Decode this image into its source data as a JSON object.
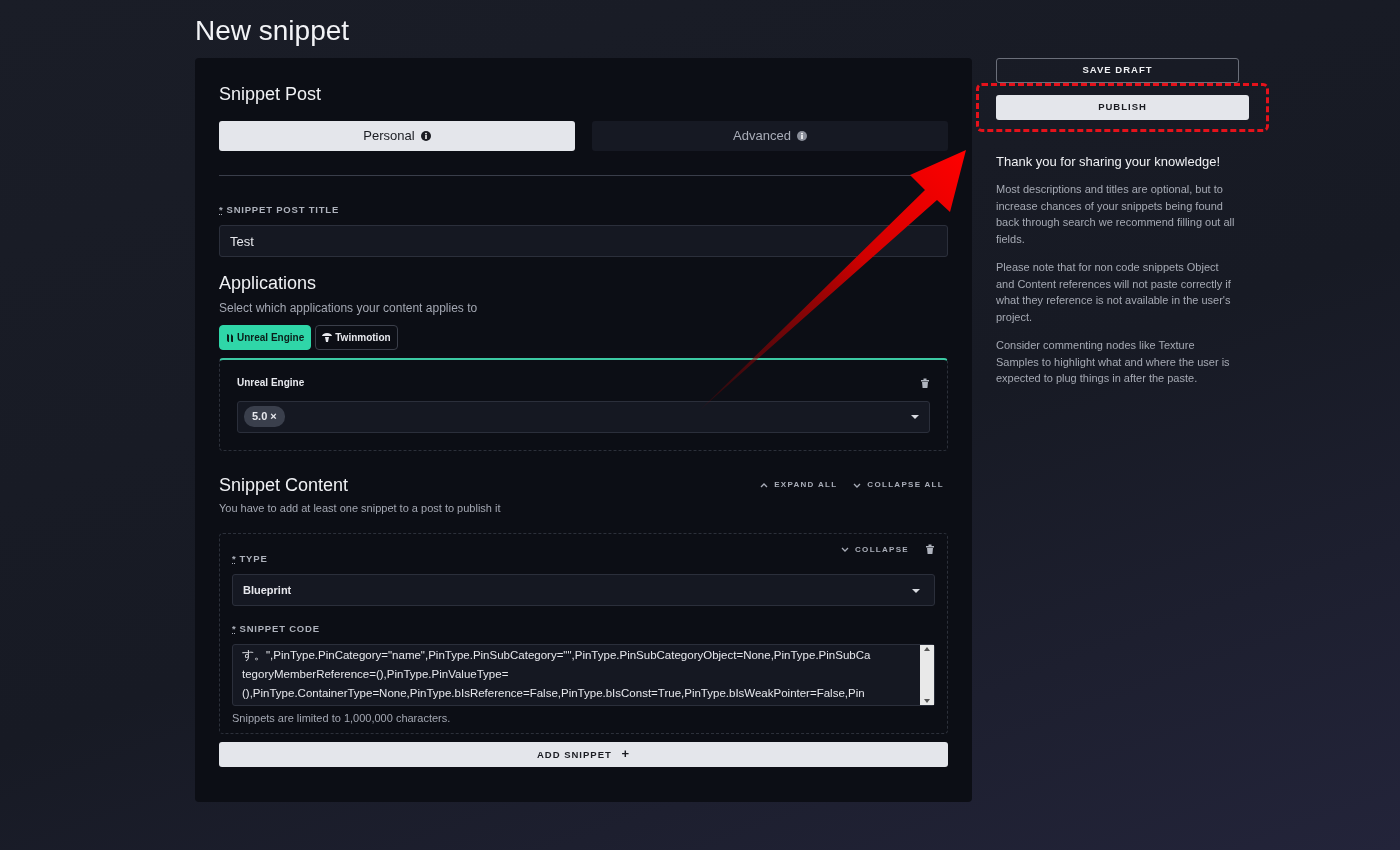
{
  "page_title": "New snippet",
  "form": {
    "heading": "Snippet Post",
    "tabs": [
      {
        "label": "Personal",
        "selected": true
      },
      {
        "label": "Advanced",
        "selected": false
      }
    ],
    "title_field": {
      "required_mark": "*",
      "label": "SNIPPET POST TITLE",
      "value": "Test"
    },
    "applications": {
      "heading": "Applications",
      "hint": "Select which applications your content applies to",
      "chips": [
        {
          "label": "Unreal Engine",
          "selected": true
        },
        {
          "label": "Twinmotion",
          "selected": false
        }
      ],
      "panel": {
        "label": "Unreal Engine",
        "tags": [
          "5.0"
        ],
        "tag_remove": "×"
      }
    },
    "content": {
      "heading": "Snippet Content",
      "hint": "You have to add at least one snippet to a post to publish it",
      "expand_all": "EXPAND ALL",
      "collapse_all": "COLLAPSE ALL",
      "snippet": {
        "collapse": "COLLAPSE",
        "type_field": {
          "required_mark": "*",
          "label": "TYPE",
          "value": "Blueprint"
        },
        "code_field": {
          "required_mark": "*",
          "label": "SNIPPET CODE",
          "lines": [
            "す。\",PinType.PinCategory=\"name\",PinType.PinSubCategory=\"\",PinType.PinSubCategoryObject=None,PinType.PinSubCa",
            "tegoryMemberReference=(),PinType.PinValueType=",
            "(),PinType.ContainerType=None,PinType.bIsReference=False,PinType.bIsConst=True,PinType.bIsWeakPointer=False,Pin"
          ]
        },
        "limit_note": "Snippets are limited to 1,000,000 characters."
      },
      "add_button": "ADD SNIPPET",
      "add_icon": "+"
    }
  },
  "sidebar": {
    "save_draft": "SAVE DRAFT",
    "publish": "PUBLISH",
    "thanks": "Thank you for sharing your knowledge!",
    "paragraphs": [
      "Most descriptions and titles are optional, but to increase chances of your snippets being found back through search we recommend filling out all fields.",
      "Please note that for non code snippets Object and Content references will not paste correctly if what they reference is not available in the user's project.",
      "Consider commenting nodes like Texture Samples to highlight what and where the user is expected to plug things in after the paste."
    ]
  },
  "callout": {
    "frame": true,
    "arrow": true
  }
}
